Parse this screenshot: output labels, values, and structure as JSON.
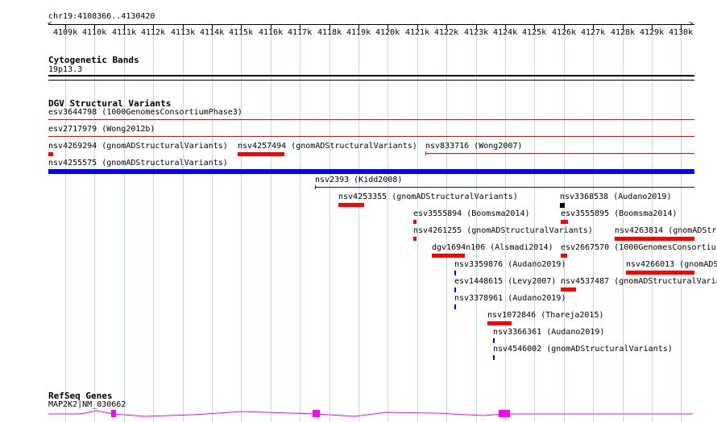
{
  "position": "chr19:4108366..4130420",
  "ruler_ticks": [
    "4109k",
    "4110k",
    "4111k",
    "4112k",
    "4113k",
    "4114k",
    "4115k",
    "4116k",
    "4117k",
    "4118k",
    "4119k",
    "4120k",
    "4121k",
    "4122k",
    "4123k",
    "4124k",
    "4125k",
    "4126k",
    "4127k",
    "4128k",
    "4129k",
    "4130k"
  ],
  "tracks": {
    "cyto": {
      "title": "Cytogenetic Bands",
      "band": "19p13.3"
    },
    "dgv": {
      "title": "DGV Structural Variants",
      "features": [
        {
          "label": "esv3644798 (1000GenomesConsortiumPhase3)"
        },
        {
          "label": "esv2717979 (Wong2012b)"
        },
        {
          "label": "nsv4269294 (gnomADStructuralVariants)"
        },
        {
          "label": "nsv4257494 (gnomADStructuralVariants)"
        },
        {
          "label": "nsv833716 (Wong2007)"
        },
        {
          "label": "nsv4255575 (gnomADStructuralVariants)"
        },
        {
          "label": "nsv2393 (Kidd2008)"
        },
        {
          "label": "nsv4253355 (gnomADStructuralVariants)"
        },
        {
          "label": "nsv3368538 (Audano2019)"
        },
        {
          "label": "esv3555894 (Boomsma2014)"
        },
        {
          "label": "esv3555895 (Boomsma2014)"
        },
        {
          "label": "nsv4261255 (gnomADStructuralVariants)"
        },
        {
          "label": "nsv4263814 (gnomADStru"
        },
        {
          "label": "dgv1694n106 (Alsmadi2014)"
        },
        {
          "label": "esv2667570 (1000GenomesConsortiu"
        },
        {
          "label": "nsv3359876 (Audano2019)"
        },
        {
          "label": "nsv4266013 (gnomADS"
        },
        {
          "label": "esv1448615 (Levy2007)"
        },
        {
          "label": "nsv4537487 (gnomADStructuralVaria"
        },
        {
          "label": "nsv3378961 (Audano2019)"
        },
        {
          "label": "nsv1072846 (Thareja2015)"
        },
        {
          "label": "nsv3366361 (Audano2019)"
        },
        {
          "label": "nsv4546002 (gnomADStructuralVariants)"
        }
      ]
    },
    "refseq": {
      "title": "RefSeq Genes",
      "gene": "MAP2K2|NM_030662"
    }
  },
  "colors": {
    "loss": "#ff0000",
    "gain": "#0000ff",
    "complex": "#000000",
    "gene": "#ff00ff",
    "grid": "#b7dcef"
  }
}
